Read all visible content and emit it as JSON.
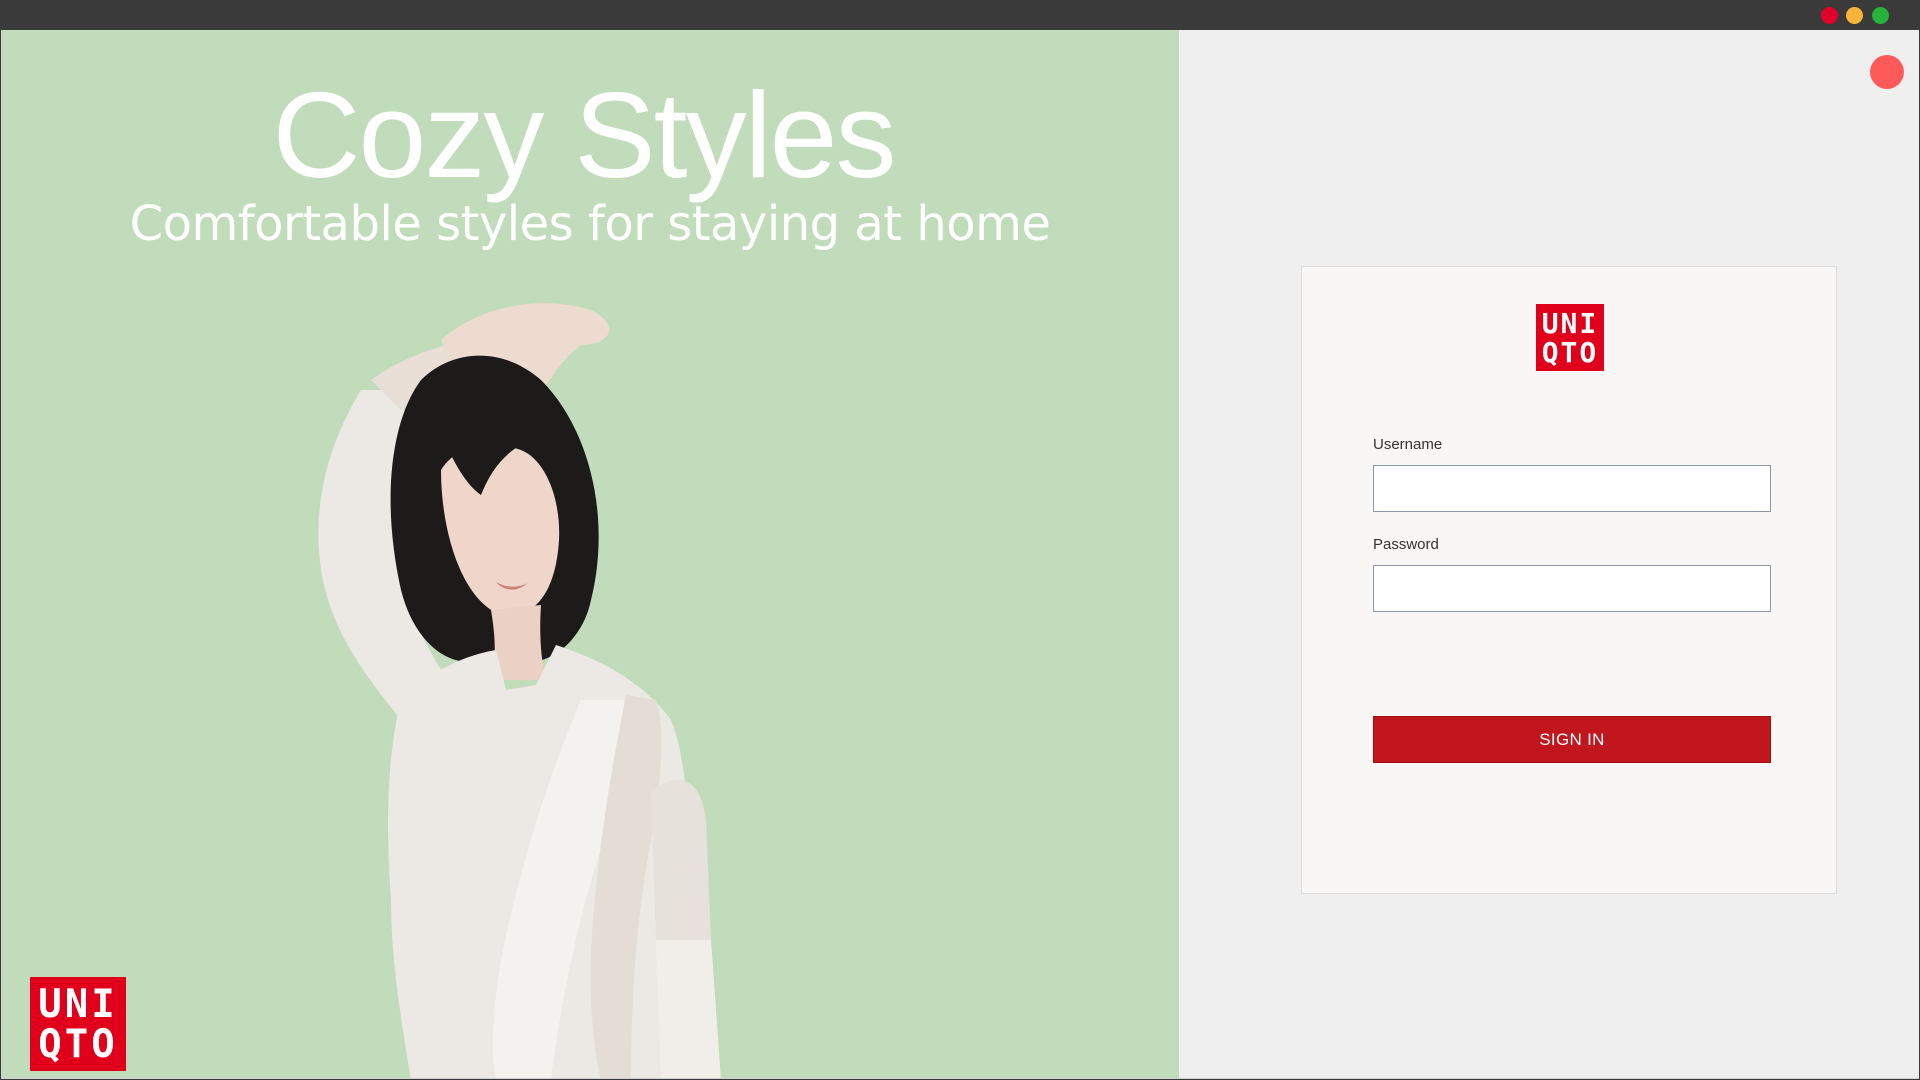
{
  "colors": {
    "hero_bg": "#c1dcba",
    "traffic_close": "#e0002a",
    "traffic_min": "#f6b43a",
    "traffic_max": "#27b23a",
    "corner_dot": "#ff5a5a",
    "brand_red": "#e0001b",
    "signin_red": "#c1161d"
  },
  "hero": {
    "title": "Cozy Styles",
    "subtitle": "Comfortable styles for staying at home"
  },
  "brand": {
    "logo_line1": "UNI",
    "logo_line2": "QTO"
  },
  "login": {
    "username_label": "Username",
    "username_value": "",
    "password_label": "Password",
    "password_value": "",
    "signin_label": "SIGN IN"
  }
}
